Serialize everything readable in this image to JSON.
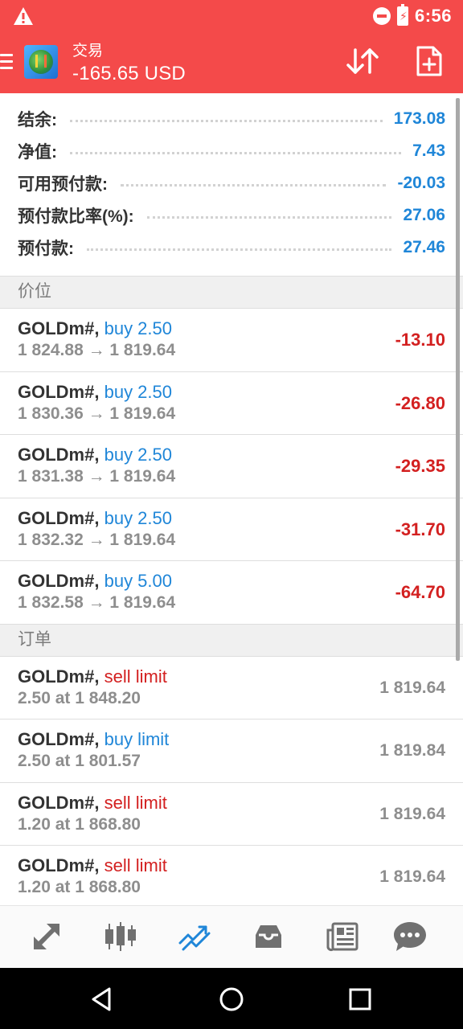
{
  "status_bar": {
    "time": "6:56"
  },
  "toolbar": {
    "title": "交易",
    "balance_text": "-165.65 USD"
  },
  "summary": [
    {
      "label": "结余:",
      "value": "173.08"
    },
    {
      "label": "净值:",
      "value": "7.43"
    },
    {
      "label": "可用预付款:",
      "value": "-20.03"
    },
    {
      "label": "预付款比率(%):",
      "value": "27.06"
    },
    {
      "label": "预付款:",
      "value": "27.46"
    }
  ],
  "positions": {
    "header": "价位",
    "items": [
      {
        "symbol": "GOLDm#,",
        "action": "buy 2.50",
        "prices": "1 824.88 → 1 819.64",
        "profit": "-13.10"
      },
      {
        "symbol": "GOLDm#,",
        "action": "buy 2.50",
        "prices": "1 830.36 → 1 819.64",
        "profit": "-26.80"
      },
      {
        "symbol": "GOLDm#,",
        "action": "buy 2.50",
        "prices": "1 831.38 → 1 819.64",
        "profit": "-29.35"
      },
      {
        "symbol": "GOLDm#,",
        "action": "buy 2.50",
        "prices": "1 832.32 → 1 819.64",
        "profit": "-31.70"
      },
      {
        "symbol": "GOLDm#,",
        "action": "buy 5.00",
        "prices": "1 832.58 → 1 819.64",
        "profit": "-64.70"
      }
    ]
  },
  "orders": {
    "header": "订单",
    "items": [
      {
        "symbol": "GOLDm#,",
        "action": "sell limit",
        "detail": "2.50 at 1 848.20",
        "price": "1 819.64"
      },
      {
        "symbol": "GOLDm#,",
        "action": "buy limit",
        "detail": "2.50 at 1 801.57",
        "price": "1 819.84"
      },
      {
        "symbol": "GOLDm#,",
        "action": "sell limit",
        "detail": "1.20 at 1 868.80",
        "price": "1 819.64"
      },
      {
        "symbol": "GOLDm#,",
        "action": "sell limit",
        "detail": "1.20 at 1 868.80",
        "price": "1 819.64"
      }
    ]
  },
  "colors": {
    "brand": "#f44a4a",
    "buy": "#1f86d8",
    "sell": "#d32020",
    "value": "#1f86d8"
  },
  "icons": {
    "bottom_nav": [
      "quotes-icon",
      "chart-icon",
      "trade-icon",
      "history-icon",
      "news-icon",
      "chat-icon"
    ],
    "active_nav": "trade-icon"
  }
}
